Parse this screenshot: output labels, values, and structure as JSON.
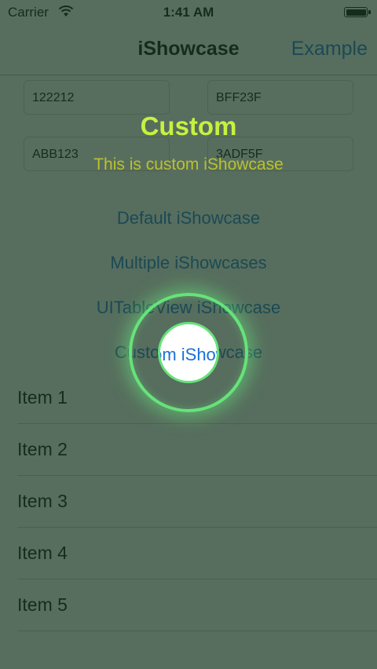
{
  "status_bar": {
    "carrier": "Carrier",
    "time": "1:41 AM"
  },
  "nav": {
    "title": "iShowcase",
    "right_button": "Example"
  },
  "fields": {
    "field1": "122212",
    "field2": "BFF23F",
    "field3": "ABB123",
    "field4": "3ADF5F"
  },
  "buttons": {
    "default": "Default iShowcase",
    "multiple": "Multiple iShowcases",
    "tableview": "UITableView iShowcase",
    "custom": "Custom iShowcase"
  },
  "table": {
    "items": [
      "Item 1",
      "Item 2",
      "Item 3",
      "Item 4",
      "Item 5"
    ]
  },
  "showcase": {
    "title": "Custom",
    "description": "This is custom iShowcase",
    "highlight_label": "Custom iShowcase",
    "colors": {
      "overlay": "#1d3c26",
      "title": "#c6f23f",
      "description": "#bdc12c",
      "ring": "#66e37a"
    }
  },
  "accent_color": "#1a6fd9"
}
